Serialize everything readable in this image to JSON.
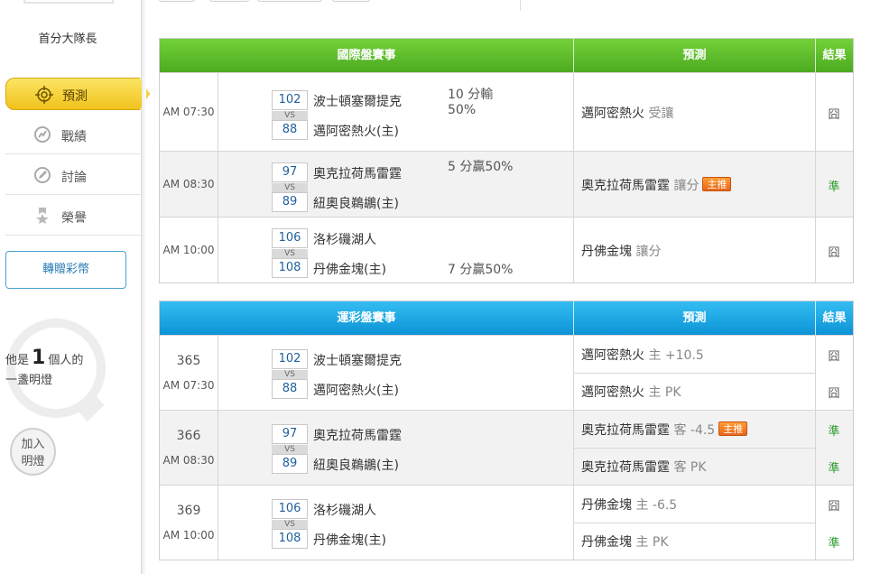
{
  "sidebar": {
    "username": "首分大隊長",
    "nav": [
      {
        "label": "預測",
        "icon": "target-icon",
        "active": true
      },
      {
        "label": "戰績",
        "icon": "chart-icon"
      },
      {
        "label": "討論",
        "icon": "edit-icon"
      },
      {
        "label": "榮譽",
        "icon": "ribbon-icon"
      }
    ],
    "gift_button": "轉贈彩幣",
    "bulb": {
      "prefix": "他是",
      "count": "1",
      "suffix": "個人的",
      "line2": "一盞明燈"
    },
    "join_line1": "加入",
    "join_line2": "明燈"
  },
  "colors": {
    "green_header": "#4caa20",
    "blue_header": "#0c93d6",
    "hit": "#2b9a2b",
    "badge": "#e6651a"
  },
  "table1": {
    "headers": {
      "game": "國際盤賽事",
      "prediction": "預測",
      "result": "結果"
    },
    "rows": [
      {
        "time": "AM 07:30",
        "away_score": "102",
        "vs": "VS",
        "home_score": "88",
        "away_team": "波士頓塞爾提克",
        "home_team": "邁阿密熱火(主)",
        "line1": "10 分輸",
        "line2": "50%",
        "pred_team": "邁阿密熱火",
        "pred_type": "受讓",
        "badge": "",
        "result": "囧"
      },
      {
        "time": "AM 08:30",
        "away_score": "97",
        "vs": "VS",
        "home_score": "89",
        "away_team": "奧克拉荷馬雷霆",
        "home_team": "紐奧良鵜鶘(主)",
        "line1": "5 分贏50%",
        "pred_team": "奧克拉荷馬雷霆",
        "pred_type": "讓分",
        "badge": "主推",
        "result": "準"
      },
      {
        "time": "AM 10:00",
        "away_score": "106",
        "vs": "VS",
        "home_score": "108",
        "away_team": "洛杉磯湖人",
        "home_team": "丹佛金塊(主)",
        "line1": "7 分贏50%",
        "pred_team": "丹佛金塊",
        "pred_type": "讓分",
        "badge": "",
        "result": "囧"
      }
    ]
  },
  "table2": {
    "headers": {
      "game": "運彩盤賽事",
      "prediction": "預測",
      "result": "結果"
    },
    "rows": [
      {
        "code": "365",
        "time": "AM 07:30",
        "away_score": "102",
        "vs": "VS",
        "home_score": "88",
        "away_team": "波士頓塞爾提克",
        "home_team": "邁阿密熱火(主)",
        "preds": [
          {
            "team": "邁阿密熱火",
            "detail": "主 +10.5",
            "badge": "",
            "result": "囧"
          },
          {
            "team": "邁阿密熱火",
            "detail": "主 PK",
            "badge": "",
            "result": "囧"
          }
        ]
      },
      {
        "code": "366",
        "time": "AM 08:30",
        "away_score": "97",
        "vs": "VS",
        "home_score": "89",
        "away_team": "奧克拉荷馬雷霆",
        "home_team": "紐奧良鵜鶘(主)",
        "preds": [
          {
            "team": "奧克拉荷馬雷霆",
            "detail": "客 -4.5",
            "badge": "主推",
            "result": "準"
          },
          {
            "team": "奧克拉荷馬雷霆",
            "detail": "客 PK",
            "badge": "",
            "result": "準"
          }
        ]
      },
      {
        "code": "369",
        "time": "AM 10:00",
        "away_score": "106",
        "vs": "VS",
        "home_score": "108",
        "away_team": "洛杉磯湖人",
        "home_team": "丹佛金塊(主)",
        "preds": [
          {
            "team": "丹佛金塊",
            "detail": "主 -6.5",
            "badge": "",
            "result": "囧"
          },
          {
            "team": "丹佛金塊",
            "detail": "主 PK",
            "badge": "",
            "result": "準"
          }
        ]
      }
    ]
  }
}
